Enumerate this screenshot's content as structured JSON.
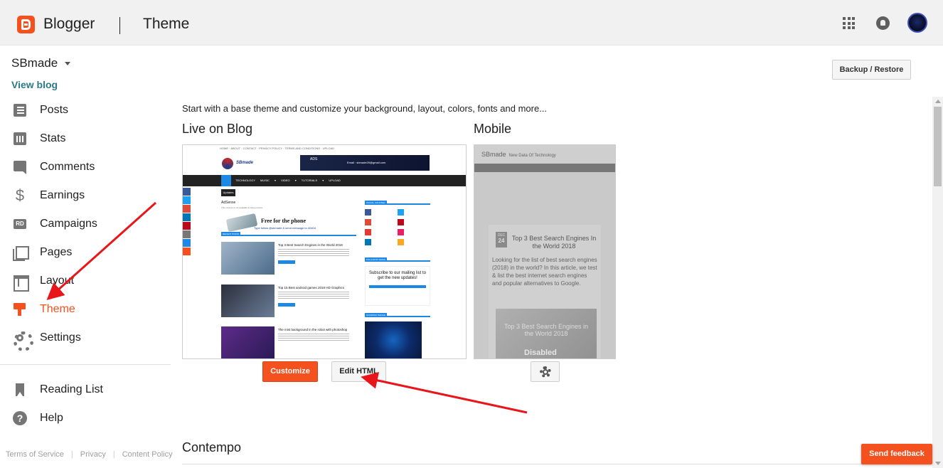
{
  "header": {
    "app_name": "Blogger",
    "page_name": "Theme"
  },
  "sidebar": {
    "blog_name": "SBmade",
    "view_blog": "View blog",
    "items": [
      {
        "label": "Posts",
        "icon": "posts-icon"
      },
      {
        "label": "Stats",
        "icon": "stats-icon"
      },
      {
        "label": "Comments",
        "icon": "comments-icon"
      },
      {
        "label": "Earnings",
        "icon": "earnings-icon"
      },
      {
        "label": "Campaigns",
        "icon": "campaigns-icon"
      },
      {
        "label": "Pages",
        "icon": "pages-icon"
      },
      {
        "label": "Layout",
        "icon": "layout-icon"
      },
      {
        "label": "Theme",
        "icon": "theme-icon",
        "active": true
      },
      {
        "label": "Settings",
        "icon": "settings-icon"
      }
    ],
    "secondary_items": [
      {
        "label": "Reading List",
        "icon": "reading-list-icon"
      },
      {
        "label": "Help",
        "icon": "help-icon"
      }
    ],
    "footer_links": [
      "Terms of Service",
      "Privacy",
      "Content Policy"
    ]
  },
  "main": {
    "backup_restore_label": "Backup / Restore",
    "intro_text": "Start with a base theme and customize your background, layout, colors, fonts and more...",
    "live_title": "Live on Blog",
    "mobile_title": "Mobile",
    "customize_label": "Customize",
    "edit_html_label": "Edit HTML",
    "next_theme_title": "Contempo",
    "send_feedback_label": "Send feedback"
  },
  "live_preview": {
    "ad_label": "ADS",
    "ad_email": "Email : sbmade29@gmail.com",
    "nav_items": "TECHNOLOGY MUSIC ▾ VIDEO ▾ TUTORIALS ▾ UPLOAD",
    "updates": "Updates",
    "adsense_title": "AdSense",
    "adsense_sub": "This content is not available in blog preview.",
    "banner_title": "Free for the phone",
    "banner_sub": "Type follow @sbmade & send message to 40404",
    "recent_posts": "RECENT POSTS",
    "posts": [
      {
        "title": "Top 3 Best Search Engines in the World 2018"
      },
      {
        "title": "Top 15 Best android games 2018 HD Graphics"
      },
      {
        "title": "The mist background in the robot with photoshop"
      }
    ],
    "social_counter": "SOCIAL COUNTER",
    "follow_by_email": "FOLLOW BY EMAIL",
    "subscribe_text": "Subscribe to our mailing list to get the new updates!",
    "goodway_badge": "GOODWAY BADGE"
  },
  "mobile_preview": {
    "site_name": "SBmade",
    "tagline": "New Data Of Technology",
    "date_month": "DEC",
    "date_day": "24",
    "post_title": "Top 3 Best Search Engines In the World 2018",
    "post_body": "Looking for the list of best search engines (2018) in the world? In this article, we test & list the best internet search engines and popular alternatives to Google.",
    "image_text": "Top 3 Best Search Engines in the World 2018",
    "image_overlay": "Disabled"
  },
  "colors": {
    "accent": "#f4511e",
    "header_bg": "#f1f1f1",
    "link": "#2b7a8a",
    "annotation_arrow": "#e8161b"
  }
}
